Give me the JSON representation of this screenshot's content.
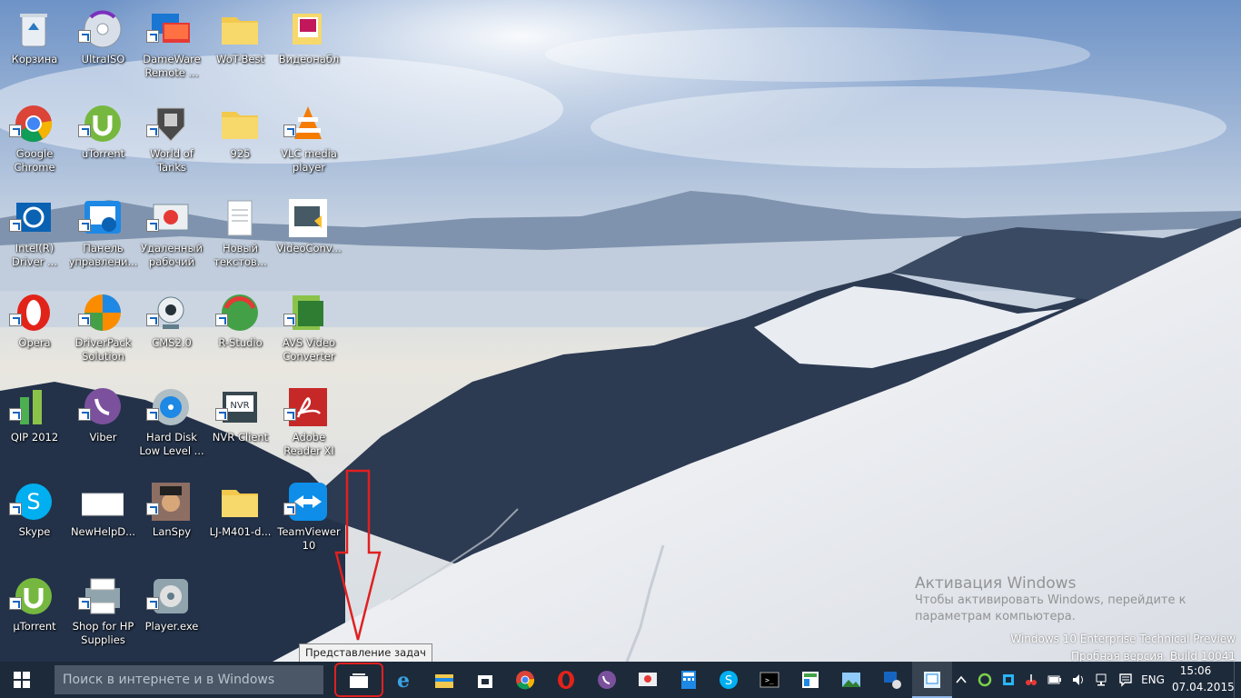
{
  "desktop": {
    "icons": [
      {
        "label": "Корзина",
        "icon": "recycle-bin-icon"
      },
      {
        "label": "UltraISO",
        "icon": "ultraiso-icon"
      },
      {
        "label": "DameWare Remote ...",
        "icon": "dameware-icon"
      },
      {
        "label": "WoT-Best",
        "icon": "folder-icon"
      },
      {
        "label": "Видеонабл",
        "icon": "video-folder-icon"
      },
      {
        "label": "Google Chrome",
        "icon": "chrome-icon"
      },
      {
        "label": "uTorrent",
        "icon": "utorrent-icon"
      },
      {
        "label": "World of Tanks",
        "icon": "world-of-tanks-icon"
      },
      {
        "label": "925",
        "icon": "folder-icon"
      },
      {
        "label": "VLC media player",
        "icon": "vlc-icon"
      },
      {
        "label": "Intel(R) Driver ...",
        "icon": "intel-driver-icon"
      },
      {
        "label": "Панель управлени...",
        "icon": "intel-panel-icon"
      },
      {
        "label": "Удаленный рабочий ст...",
        "icon": "remote-desktop-icon"
      },
      {
        "label": "Новый текстов...",
        "icon": "text-document-icon"
      },
      {
        "label": "VideoConv...",
        "icon": "videoconverter-icon"
      },
      {
        "label": "Opera",
        "icon": "opera-icon"
      },
      {
        "label": "DriverPack Solution",
        "icon": "driverpack-icon"
      },
      {
        "label": "CMS2.0",
        "icon": "webcam-icon"
      },
      {
        "label": "R-Studio",
        "icon": "r-studio-icon"
      },
      {
        "label": "AVS Video Converter",
        "icon": "avs-icon"
      },
      {
        "label": "QIP 2012",
        "icon": "qip-icon"
      },
      {
        "label": "Viber",
        "icon": "viber-icon"
      },
      {
        "label": "Hard Disk Low Level ...",
        "icon": "hard-disk-icon"
      },
      {
        "label": "NVR Client",
        "icon": "nvr-icon"
      },
      {
        "label": "Adobe Reader XI",
        "icon": "adobe-reader-icon"
      },
      {
        "label": "Skype",
        "icon": "skype-icon"
      },
      {
        "label": "NewHelpD...",
        "icon": "blank-file-icon"
      },
      {
        "label": "LanSpy",
        "icon": "lanspy-icon"
      },
      {
        "label": "LJ-M401-d...",
        "icon": "folder-icon"
      },
      {
        "label": "TeamViewer 10",
        "icon": "teamviewer-icon"
      },
      {
        "label": "µTorrent",
        "icon": "utorrent-icon"
      },
      {
        "label": "Shop for HP Supplies",
        "icon": "hp-printer-icon"
      },
      {
        "label": "Player.exe",
        "icon": "player-icon"
      }
    ]
  },
  "watermark": {
    "title": "Активация Windows",
    "text": "Чтобы активировать Windows, перейдите к параметрам компьютера."
  },
  "build_info": {
    "line1": "Windows 10 Enterprise Technical Preview",
    "line2": "Пробная версия. Build 10041"
  },
  "tooltip": "Представление задач",
  "taskbar": {
    "search_placeholder": "Поиск в интернете и в Windows",
    "apps": [
      "internet-explorer-icon",
      "file-explorer-icon",
      "store-icon",
      "chrome-icon",
      "opera-icon",
      "viber-icon",
      "remote-desktop-icon",
      "calculator-icon",
      "skype-icon",
      "command-prompt-icon",
      "spreadsheet-icon",
      "image-viewer-icon",
      "network-tool-icon",
      "paint-icon"
    ],
    "tray": [
      "show-hidden-icons-chevron",
      "sync-icon",
      "network-adapter-icon",
      "tools-icon",
      "battery-icon",
      "volume-icon",
      "network-icon",
      "action-center-icon"
    ],
    "language": "ENG",
    "time": "15:06",
    "date": "07.04.2015"
  },
  "colors": {
    "taskbar": "#1d2a3a",
    "search_box": "#4b5766",
    "highlight_red": "#e02020"
  }
}
